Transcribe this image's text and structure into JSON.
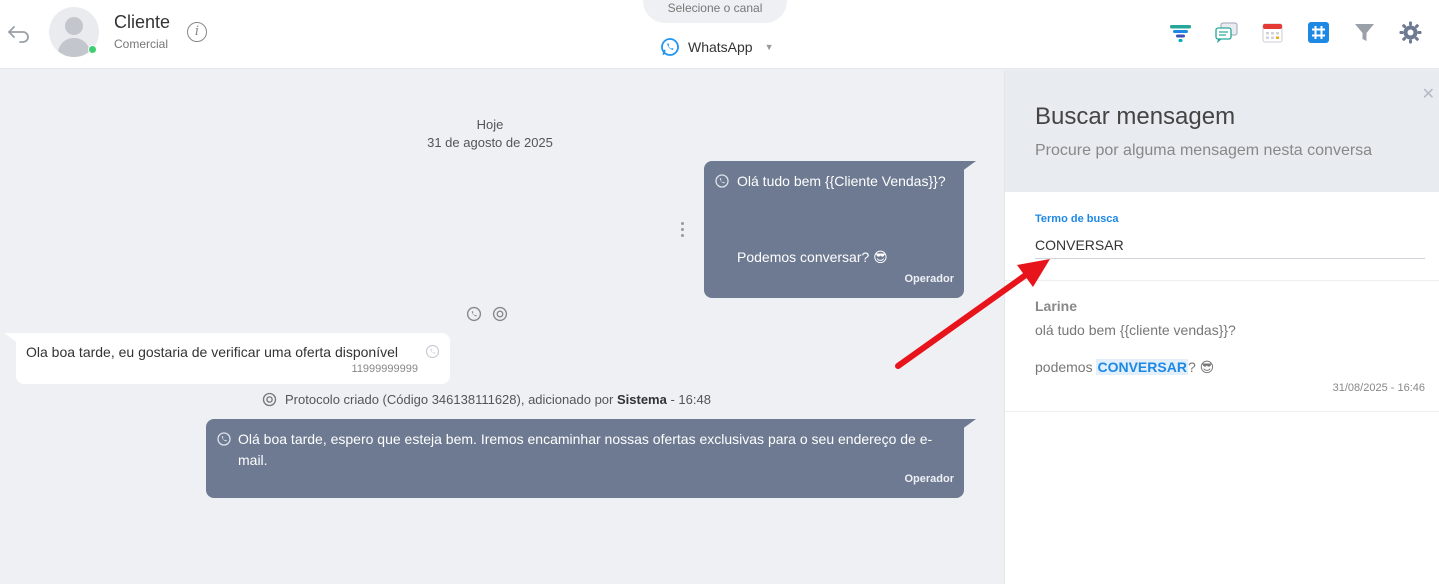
{
  "header": {
    "contact_name": "Cliente",
    "contact_sub": "Comercial",
    "channel_prompt": "Selecione o canal",
    "channel": "WhatsApp",
    "tool_icons": [
      "funnel-colored-icon",
      "chat-bubbles-icon",
      "calendar-icon",
      "hashtag-icon",
      "filter-icon",
      "gear-icon"
    ]
  },
  "chat": {
    "date_label": "Hoje",
    "date_full": "31 de agosto de 2025",
    "msg1_line1": "Olá tudo bem {{Cliente Vendas}}?",
    "msg1_line2": "Podemos conversar? 😎",
    "msg1_sender": "Operador",
    "msg2_text": "Ola boa tarde, eu gostaria de verificar uma oferta disponível",
    "msg2_number": "11999999999",
    "protocol_text": "Protocolo criado (Código 346138111628), adicionado por",
    "protocol_user": "Sistema",
    "protocol_time": "- 16:48",
    "msg3_text": "Olá boa tarde, espero que esteja bem. Iremos encaminhar nossas ofertas exclusivas para o seu endereço de e-mail.",
    "msg3_sender": "Operador"
  },
  "search_panel": {
    "title": "Buscar mensagem",
    "subtitle": "Procure por alguma mensagem nesta conversa",
    "field_label": "Termo de busca",
    "field_value": "CONVERSAR",
    "result": {
      "name": "Larine",
      "line1": "olá tudo bem {{cliente vendas}}?",
      "line2_before": "podemos",
      "line2_highlight": "CONVERSAR",
      "line2_after": "? 😎",
      "timestamp": "31/08/2025 - 16:46"
    }
  },
  "colors": {
    "outgoing_bubble": "#6d7a91",
    "accent": "#1e88e5",
    "annotation_arrow": "#e8141b"
  }
}
